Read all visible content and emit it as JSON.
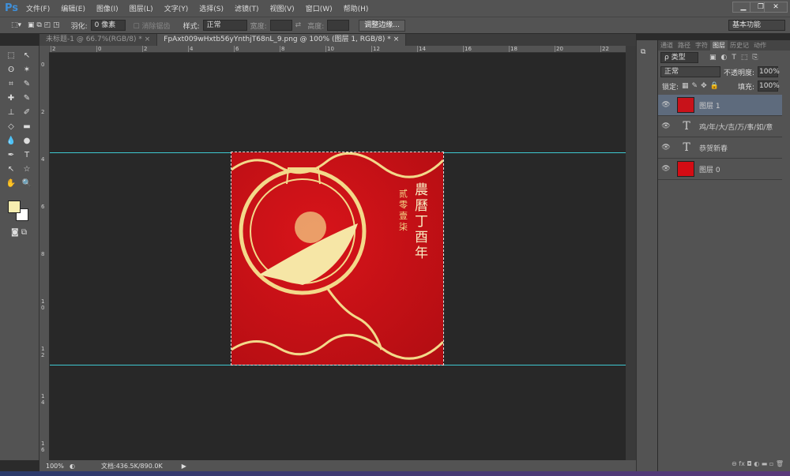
{
  "app": {
    "logo": "Ps"
  },
  "menu": [
    "文件(F)",
    "编辑(E)",
    "图像(I)",
    "图层(L)",
    "文字(Y)",
    "选择(S)",
    "滤镜(T)",
    "视图(V)",
    "窗口(W)",
    "帮助(H)"
  ],
  "window": {
    "minimize": "▁",
    "restore": "❐",
    "close": "✕"
  },
  "options": {
    "feather_label": "羽化:",
    "feather_value": "0 像素",
    "antialias_label": "消除锯齿",
    "style_label": "样式:",
    "style_value": "正常",
    "width_label": "宽度:",
    "height_label": "高度:",
    "refine_edge": "调整边缘...",
    "workspace": "基本功能"
  },
  "tabs": [
    {
      "label": "未标题-1 @ 66.7%(RGB/8) *",
      "close": "×"
    },
    {
      "label": "FpAxt009wHxtb56yYnthjT68nL_9.png @ 100% (图层 1, RGB/8) *",
      "close": "×"
    }
  ],
  "ruler": {
    "h": [
      "2",
      "0",
      "2",
      "4",
      "6",
      "8",
      "10",
      "12",
      "14",
      "16",
      "18",
      "20",
      "22",
      "24"
    ],
    "v": [
      "0",
      "2",
      "4",
      "6",
      "8",
      "1 0",
      "1 2",
      "1 4",
      "1 6"
    ]
  },
  "artwork": {
    "title": "農曆丁酉年",
    "subtitle": "贰零壹柒"
  },
  "panel": {
    "tabs": [
      "通道",
      "路径",
      "字符",
      "图层",
      "历史记",
      "动作"
    ],
    "filter": "ρ 类型",
    "blend": "正常",
    "opacity_label": "不透明度:",
    "opacity": "100%",
    "lock_label": "锁定:",
    "fill_label": "填充:",
    "fill": "100%",
    "layers": [
      {
        "name": "图层 1",
        "type": "image",
        "selected": true
      },
      {
        "name": "鸡/年/大/吉/万/事/如/意",
        "type": "text"
      },
      {
        "name": "恭贺新春",
        "type": "text"
      },
      {
        "name": "图层 0",
        "type": "fill",
        "color": "#d40c14"
      }
    ]
  },
  "status": {
    "zoom": "100%",
    "doc": "文档:436.5K/890.0K"
  },
  "colors": {
    "foreground": "#f7eeb0",
    "background": "#ffffff",
    "guide": "#3ec8d0"
  }
}
